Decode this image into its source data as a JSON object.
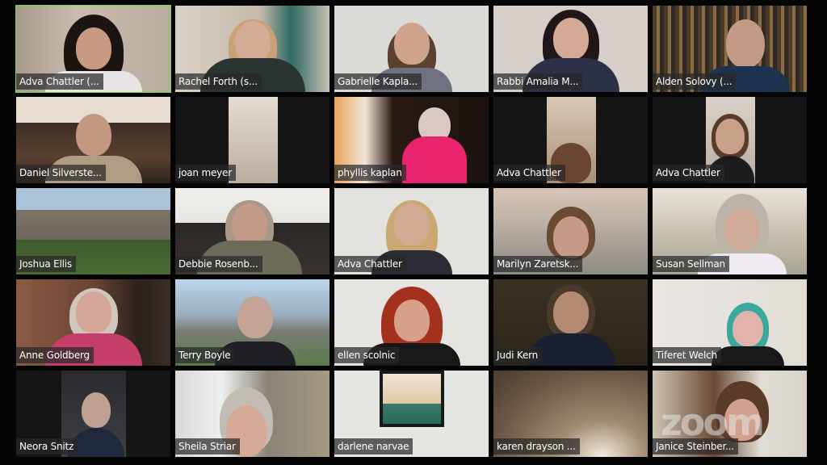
{
  "app": "Zoom",
  "view": "Gallery View",
  "active_speaker_color": "#6ee030",
  "watermark": "zoom",
  "participants": [
    {
      "name": "Adva Chattler (...",
      "active": true
    },
    {
      "name": "Rachel Forth (s..."
    },
    {
      "name": "Gabrielle Kapla..."
    },
    {
      "name": "Rabbi Amalia M..."
    },
    {
      "name": "Alden Solovy (..."
    },
    {
      "name": "Daniel Silverste..."
    },
    {
      "name": "joan meyer"
    },
    {
      "name": "phyllis kaplan"
    },
    {
      "name": "Adva Chattler"
    },
    {
      "name": "Adva Chattler"
    },
    {
      "name": "Joshua Ellis"
    },
    {
      "name": "Debbie Rosenb..."
    },
    {
      "name": "Adva Chattler"
    },
    {
      "name": "Marilyn Zaretsk..."
    },
    {
      "name": "Susan Sellman"
    },
    {
      "name": "Anne Goldberg"
    },
    {
      "name": "Terry Boyle"
    },
    {
      "name": "ellen scolnic"
    },
    {
      "name": "Judi Kern"
    },
    {
      "name": "Tiferet Welch"
    },
    {
      "name": "Neora Snitz"
    },
    {
      "name": "Sheila Striar"
    },
    {
      "name": "darlene narvae"
    },
    {
      "name": "karen drayson ..."
    },
    {
      "name": "Janice Steinber..."
    }
  ]
}
